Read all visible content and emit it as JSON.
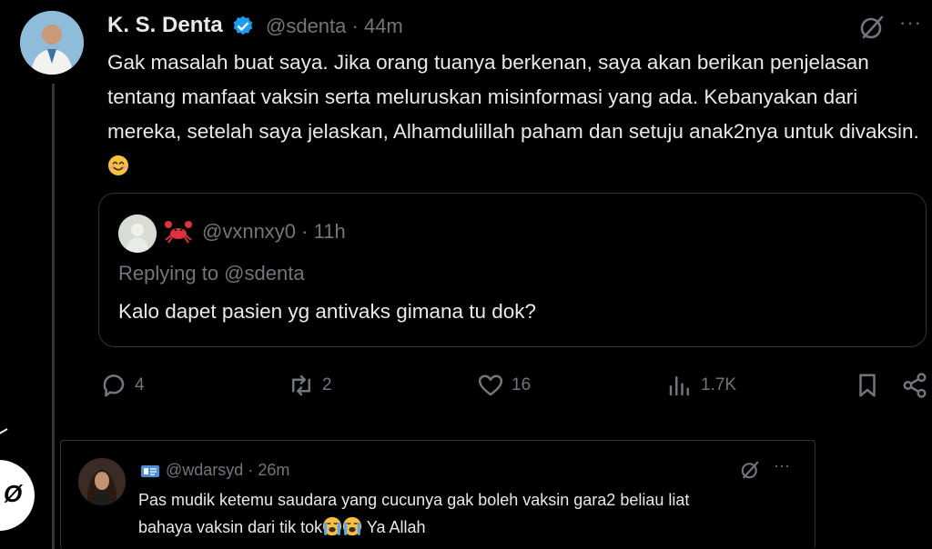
{
  "tweet": {
    "name": "K. S. Denta",
    "handle": "@sdenta",
    "time": "· 44m",
    "text": "Gak masalah buat saya. Jika orang tuanya berkenan, saya akan berikan penjelasan tentang manfaat vaksin serta meluruskan misinformasi yang ada. Kebanyakan dari mereka, setelah saya jelaskan, Alhamdulillah paham dan setuju anak2nya untuk divaksin.",
    "emoji": "smiling-face-icon",
    "verified_color": "#1d9bf0"
  },
  "quote": {
    "handle": "@vxnnxy0",
    "time": "· 11h",
    "replying": "Replying to @sdenta",
    "text": "Kalo dapet pasien yg antivaks gimana tu dok?"
  },
  "actions": {
    "replies": "4",
    "retweets": "2",
    "likes": "16",
    "views": "1.7K"
  },
  "reply": {
    "handle": "@wdarsyd",
    "time": "· 26m",
    "line1": "Pas mudik ketemu saudara yang cucunya gak boleh vaksin gara2 beliau liat",
    "line2": "bahaya vaksin dari tik tok",
    "suffix": "Ya Allah"
  },
  "colors": {
    "background": "#000000",
    "text": "#e7e9ea",
    "muted": "#71767b",
    "border": "#2f3336"
  }
}
